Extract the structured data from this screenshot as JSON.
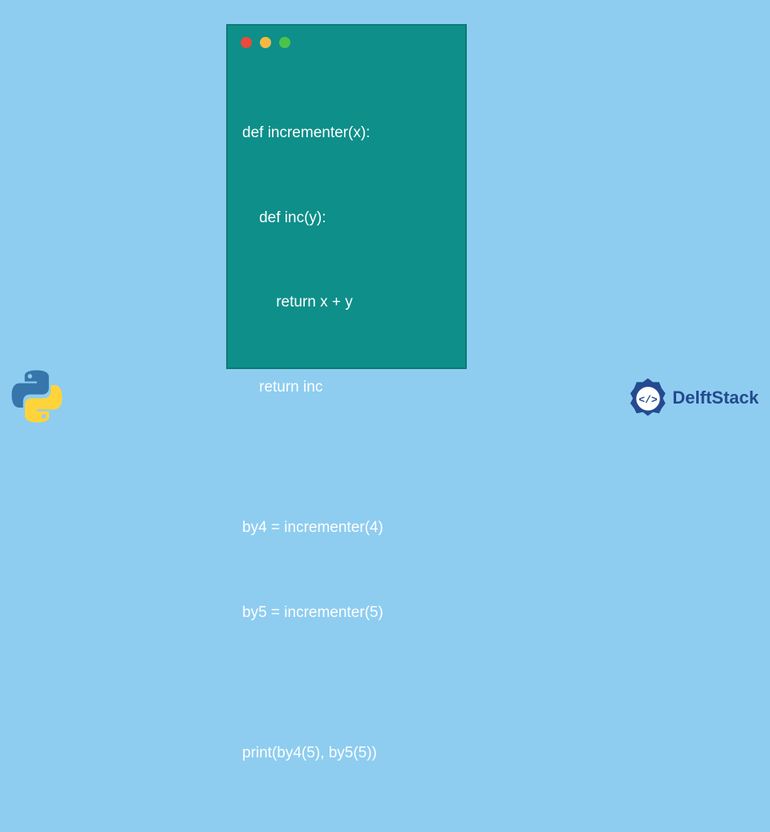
{
  "code": {
    "lines": [
      "def incrementer(x):",
      "    def inc(y):",
      "        return x + y",
      "    return inc",
      "",
      "by4 = incrementer(4)",
      "by5 = incrementer(5)",
      "",
      "print(by4(5), by5(5))"
    ]
  },
  "window": {
    "traffic_light_colors": [
      "#e94b3c",
      "#f5b942",
      "#4cc24a"
    ]
  },
  "branding": {
    "delftstack_label": "DelftStack"
  }
}
